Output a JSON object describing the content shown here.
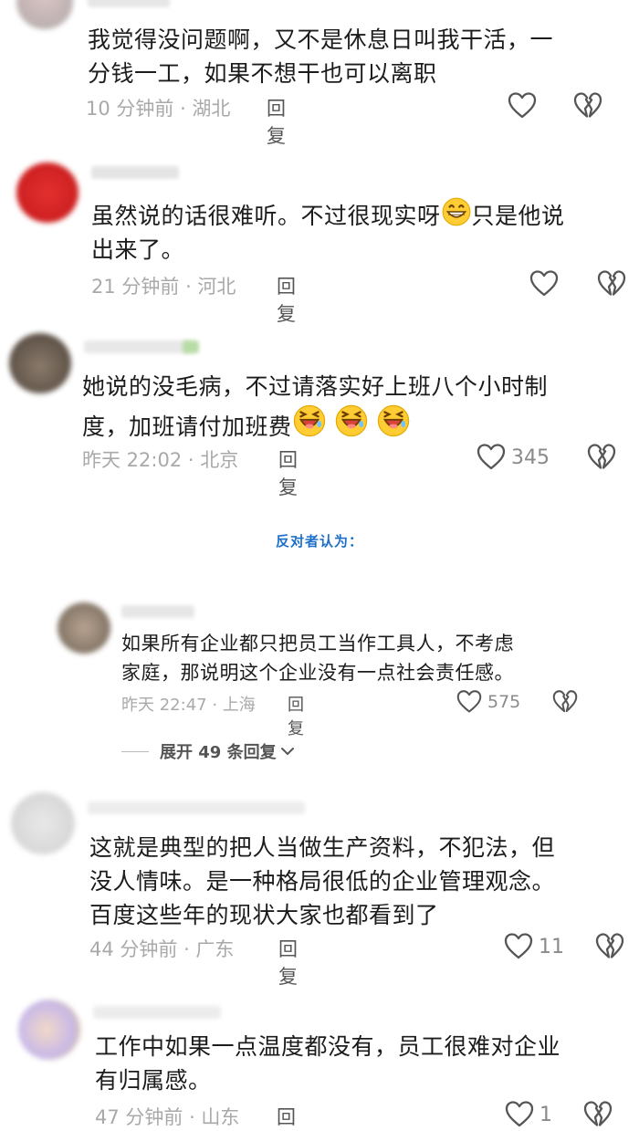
{
  "comments": [
    {
      "text_lines": [
        "我觉得没问题啊，又不是休息日叫我干活，一",
        "分钱一工，如果不想干也可以离职"
      ],
      "time": "10 分钟前 · 湖北",
      "reply": "回复",
      "likes": ""
    },
    {
      "text_lines": [
        "虽然说的话很难听。不过很现实呀",
        "只是他说",
        "出来了。"
      ],
      "time": "21 分钟前 · 河北",
      "reply": "回复",
      "likes": ""
    },
    {
      "text_lines": [
        "她说的没毛病，不过请落实好上班八个小时制",
        "度，加班请付加班费"
      ],
      "time": "昨天 22:02 · 北京",
      "reply": "回复",
      "likes": "345"
    },
    {
      "text_lines": [
        "如果所有企业都只把员工当作工具人，不考虑",
        "家庭，那说明这个企业没有一点社会责任感。"
      ],
      "time": "昨天 22:47 · 上海",
      "reply": "回复",
      "likes": "575"
    },
    {
      "text_lines": [
        "这就是典型的把人当做生产资料，不犯法，但",
        "没人情味。是一种格局很低的企业管理观念。",
        "百度这些年的现状大家也都看到了"
      ],
      "time": "44 分钟前 · 广东",
      "reply": "回复",
      "likes": "11"
    },
    {
      "text_lines": [
        "工作中如果一点温度都没有，员工很难对企业",
        "有归属感。"
      ],
      "time": "47 分钟前 · 山东",
      "reply": "回复",
      "likes": "1"
    }
  ],
  "section_title": "反对者认为：",
  "expand_label": "展开 49 条回复",
  "icons": {
    "like": "heart-outline-icon",
    "dislike": "broken-heart-icon",
    "chevron": "chevron-down-icon",
    "emoji_grin": "grinning-emoji",
    "emoji_laugh": "laughing-wink-emoji"
  },
  "colors": {
    "section_title": "#1d6fc9",
    "meta": "#a9a9a9",
    "text": "#1c1c1c"
  }
}
